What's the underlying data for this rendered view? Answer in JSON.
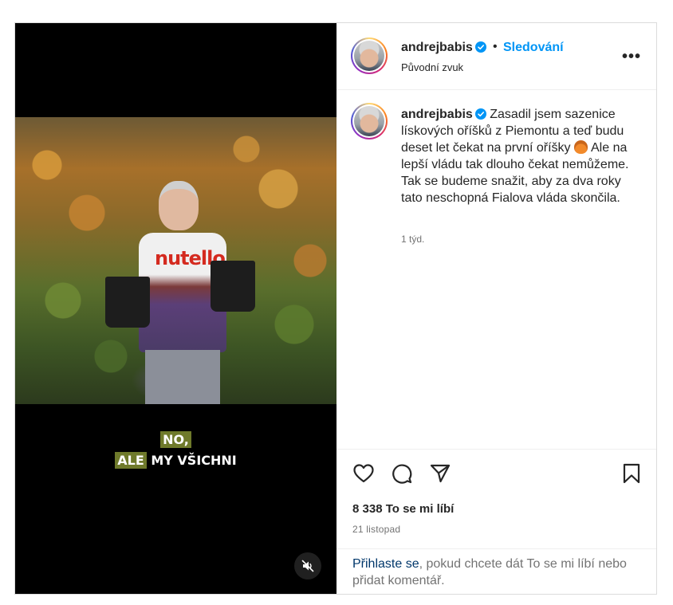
{
  "video": {
    "caption_line1": "NO,",
    "caption_line2_highlight": "ALE",
    "caption_line2_rest": " MY VŠICHNI",
    "shirt_text": "nutello"
  },
  "header": {
    "username": "andrejbabis",
    "separator": "•",
    "follow_label": "Sledování",
    "audio_label": "Původní zvuk",
    "more_label": "•••"
  },
  "comment": {
    "username": "andrejbabis",
    "text_part1": " Zasadil jsem sazenice lískových oříšků z Piemontu a teď budu deset let čekat na první oříšky ",
    "text_part2": "Ale na lepší vládu tak dlouho čekat nemůžeme. Tak se budeme snažit, aby za dva roky tato neschopná Fialova vláda skončila.",
    "time": "1 týd."
  },
  "actions": {
    "likes": "8 338 To se mi líbí",
    "date": "21 listopad",
    "login_link": "Přihlaste se",
    "login_rest": ", pokud chcete dát To se mi líbí nebo přidat komentář."
  },
  "colors": {
    "accent": "#0095f6",
    "link_dark": "#00376b",
    "muted": "#737373",
    "caption_highlight": "#6f7a2b"
  }
}
